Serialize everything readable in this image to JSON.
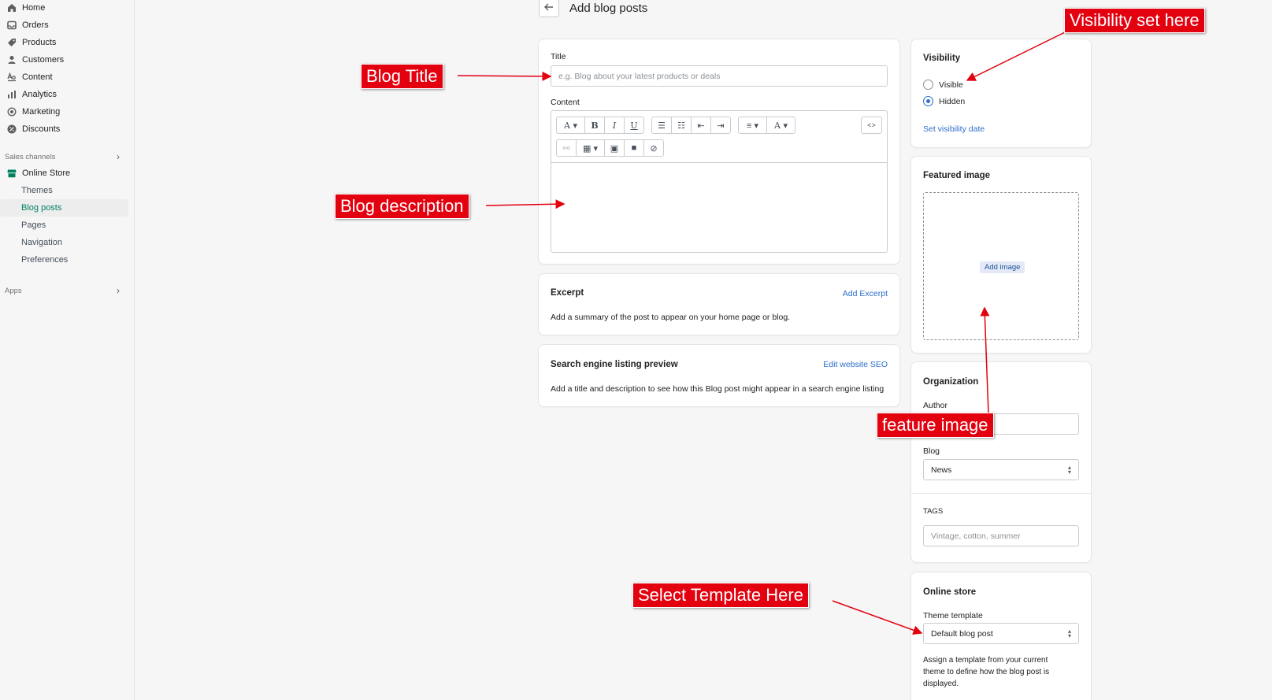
{
  "sidebar": {
    "items": [
      {
        "label": "Home",
        "icon": "home-icon"
      },
      {
        "label": "Orders",
        "icon": "orders-icon"
      },
      {
        "label": "Products",
        "icon": "tag-icon"
      },
      {
        "label": "Customers",
        "icon": "person-icon"
      },
      {
        "label": "Content",
        "icon": "content-icon"
      },
      {
        "label": "Analytics",
        "icon": "bar-chart-icon"
      },
      {
        "label": "Marketing",
        "icon": "target-icon"
      },
      {
        "label": "Discounts",
        "icon": "discount-icon"
      }
    ],
    "sales_channels_label": "Sales channels",
    "online_store_label": "Online Store",
    "sub_items": [
      "Themes",
      "Blog posts",
      "Pages",
      "Navigation",
      "Preferences"
    ],
    "apps_label": "Apps",
    "accent_color": "#008060"
  },
  "header": {
    "title": "Add blog posts"
  },
  "main": {
    "title_label": "Title",
    "title_placeholder": "e.g. Blog about your latest products or deals",
    "content_label": "Content",
    "excerpt": {
      "heading": "Excerpt",
      "action": "Add Excerpt",
      "description": "Add a summary of the post to appear on your home page or blog."
    },
    "seo": {
      "heading": "Search engine listing preview",
      "action": "Edit website SEO",
      "description": "Add a title and description to see how this Blog post might appear in a search engine listing"
    }
  },
  "visibility": {
    "heading": "Visibility",
    "options": [
      "Visible",
      "Hidden"
    ],
    "selected": "Hidden",
    "date_link": "Set visibility date"
  },
  "featured_image": {
    "heading": "Featured image",
    "button": "Add image"
  },
  "organization": {
    "heading": "Organization",
    "author_label": "Author",
    "blog_label": "Blog",
    "blog_value": "News",
    "tags_label": "TAGS",
    "tags_placeholder": "Vintage, cotton, summer"
  },
  "online_store": {
    "heading": "Online store",
    "template_label": "Theme template",
    "template_value": "Default blog post",
    "help_line1": "Assign a template from your current",
    "help_line2": "theme to define how the blog post is",
    "help_line3": "displayed."
  },
  "annotations": {
    "blog_title": "Blog Title",
    "blog_description": "Blog description",
    "visibility": "Visibility set here",
    "feature_image": "feature image",
    "template": "Select Template Here",
    "color": "#e3000f"
  }
}
